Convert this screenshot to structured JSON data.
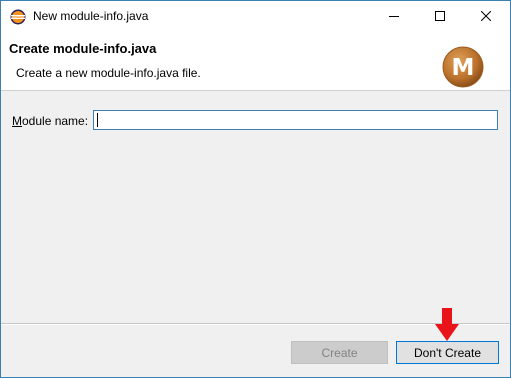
{
  "window": {
    "title": "New module-info.java",
    "controls": [
      "minimize-icon",
      "maximize-icon",
      "close-icon"
    ]
  },
  "header": {
    "title": "Create module-info.java",
    "description": "Create a new module-info.java file.",
    "logo_letter": "M"
  },
  "form": {
    "module_name_label_mnemonic": "M",
    "module_name_label_rest": "odule name:",
    "module_name_value": "",
    "module_name_placeholder": ""
  },
  "buttons": {
    "create_label": "Create",
    "dont_create_label": "Don't Create"
  },
  "colors": {
    "accent": "#0078d7",
    "window_border": "#3c7fb1",
    "logo": "#c07a2e",
    "arrow": "#e8141a"
  }
}
